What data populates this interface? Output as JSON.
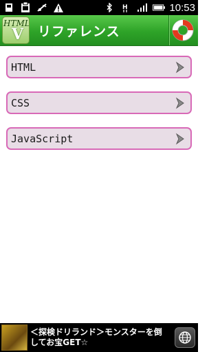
{
  "status_bar": {
    "time": "10:53",
    "left_icons": [
      "usb-icon",
      "clipboard-icon",
      "wifi-off-icon",
      "warning-icon"
    ],
    "right_icons": [
      "bluetooth-icon",
      "network-h-icon",
      "signal-icon",
      "battery-icon"
    ]
  },
  "header": {
    "title": "リファレンス",
    "logo_text": "HTML",
    "logo_letter": "V",
    "colors": {
      "bar": "#2ea328",
      "title": "#ffffff"
    }
  },
  "menu": {
    "items": [
      {
        "label": "HTML"
      },
      {
        "label": "CSS"
      },
      {
        "label": "JavaScript"
      }
    ],
    "colors": {
      "border": "#d869b7",
      "fill": "#e8dde6"
    }
  },
  "ad": {
    "text": "＜探検ドリランド＞モンスターを倒してお宝GET☆"
  }
}
